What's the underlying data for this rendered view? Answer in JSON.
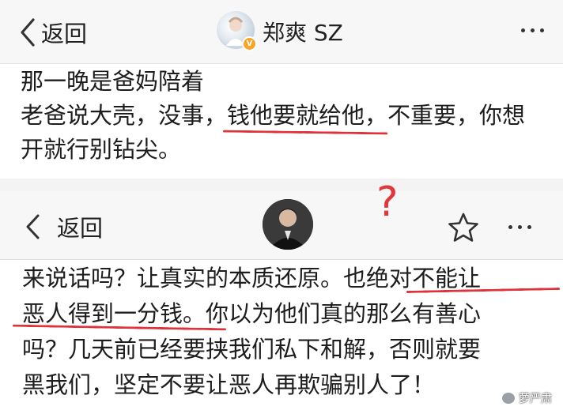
{
  "top": {
    "back_label": "返回",
    "username": "郑爽 SZ",
    "verified_mark": "V",
    "lines": [
      "那一晚是爸妈陪着",
      "老爸说大壳，没事，钱他要就给他，不重要，你想",
      "开就行别钻尖。"
    ]
  },
  "annotation": {
    "question_mark": "?"
  },
  "bottom": {
    "back_label": "返回",
    "lines": [
      "来说话吗？让真实的本质还原。也绝对不能让",
      "恶人得到一分钱。你以为他们真的那么有善心",
      "吗？几天前已经要挟我们私下和解，否则就要",
      "黑我们，坚定不要让恶人再欺骗别人了！"
    ]
  },
  "watermark": {
    "text": "萝严肃"
  },
  "colors": {
    "underline": "#e0323a",
    "header_bg": "#f7f7f7",
    "badge": "#f6a623"
  },
  "icons": [
    "chevron-left-icon",
    "more-dots-icon",
    "star-icon",
    "verified-badge-icon"
  ]
}
